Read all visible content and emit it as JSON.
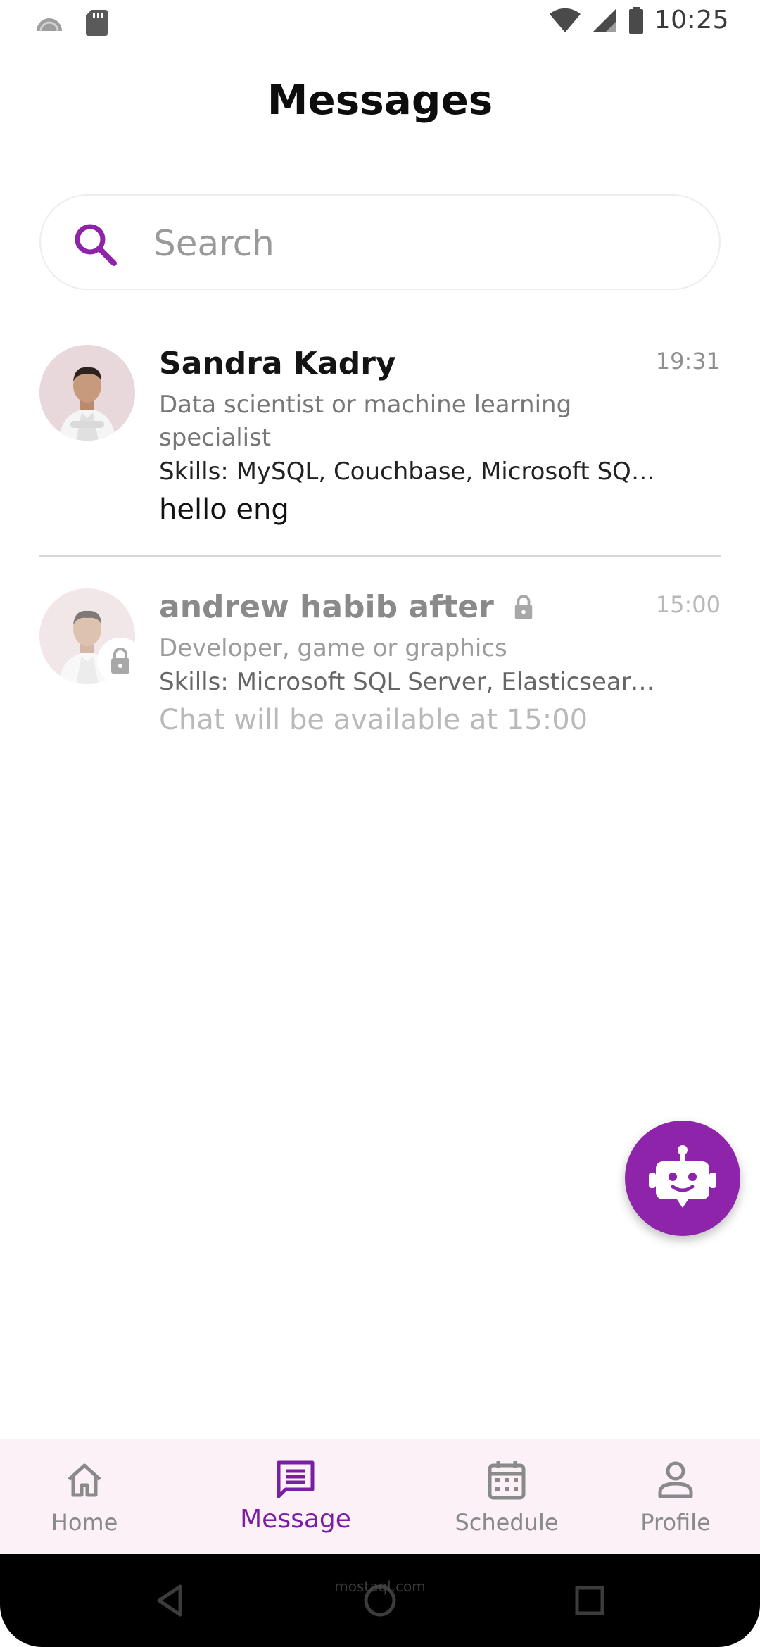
{
  "status_bar": {
    "time": "10:25"
  },
  "header": {
    "title": "Messages"
  },
  "search": {
    "placeholder": "Search",
    "value": ""
  },
  "chats": [
    {
      "name": "Sandra Kadry",
      "role": "Data scientist or machine learning specialist",
      "skills": "Skills: MySQL, Couchbase, Microsoft SQL ...",
      "last_message": "hello eng",
      "time": "19:31",
      "locked": false
    },
    {
      "name": "andrew habib after",
      "role": "Developer, game or graphics",
      "skills": "Skills: Microsoft SQL Server, Elasticsearch",
      "last_message": "Chat will be available at 15:00",
      "time": "15:00",
      "locked": true
    }
  ],
  "bottom_nav": {
    "items": [
      {
        "label": "Home",
        "icon": "home-icon",
        "active": false
      },
      {
        "label": "Message",
        "icon": "message-icon",
        "active": true
      },
      {
        "label": "Schedule",
        "icon": "calendar-icon",
        "active": false
      },
      {
        "label": "Profile",
        "icon": "profile-icon",
        "active": false
      }
    ]
  },
  "watermark": {
    "text": "mostaql.com"
  },
  "colors": {
    "accent": "#8e24aa",
    "accent_dark": "#7b1fa2",
    "nav_bg": "#fbf1f7"
  }
}
